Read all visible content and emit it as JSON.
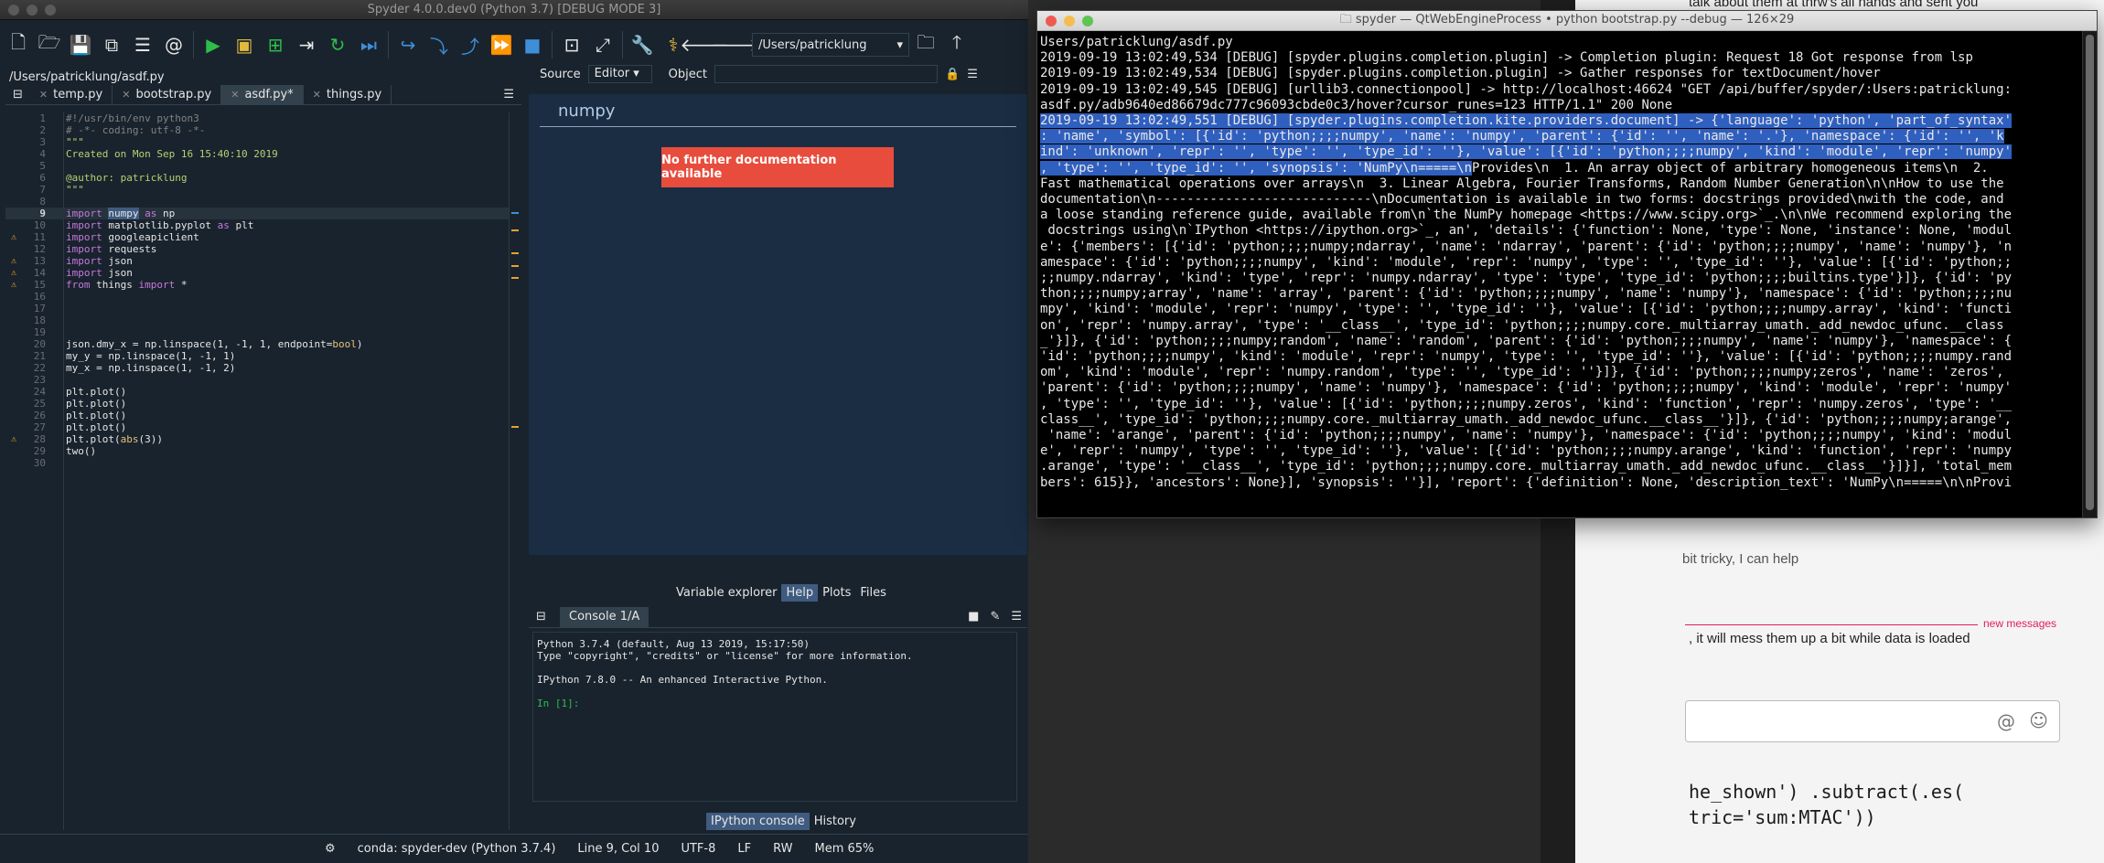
{
  "spyder": {
    "title": "Spyder 4.0.0.dev0 (Python 3.7) [DEBUG MODE 3]",
    "toolbar": {
      "path": "/Users/patricklung",
      "icons": [
        "new-file-icon",
        "open-file-icon",
        "save-icon",
        "save-all-icon",
        "list-icon",
        "at-icon",
        "run-icon",
        "run-cell-icon",
        "run-cell-advance-icon",
        "run-selection-icon",
        "rerun-icon",
        "debug-icon",
        "step-icon",
        "stop-icon",
        "maximize-icon",
        "fullscreen-icon",
        "wrench-icon",
        "python-icon",
        "back-icon",
        "forward-icon",
        "folder-icon",
        "up-icon"
      ]
    },
    "editor": {
      "filepath": "/Users/patricklung/asdf.py",
      "tabs": [
        {
          "label": "temp.py"
        },
        {
          "label": "bootstrap.py"
        },
        {
          "label": "asdf.py*"
        },
        {
          "label": "things.py"
        }
      ],
      "line_numbers": [
        "1",
        "2",
        "3",
        "4",
        "5",
        "6",
        "7",
        "8",
        "9",
        "10",
        "11",
        "12",
        "13",
        "14",
        "15",
        "16",
        "17",
        "18",
        "19",
        "20",
        "21",
        "22",
        "23",
        "24",
        "25",
        "26",
        "27",
        "28",
        "29",
        "30"
      ]
    },
    "help": {
      "source_label": "Source",
      "source_value": "Editor",
      "object_label": "Object",
      "doc_title": "numpy",
      "no_doc": "No further documentation available",
      "tabs": [
        "Variable explorer",
        "Help",
        "Plots",
        "Files"
      ]
    },
    "console": {
      "tab": "Console 1/A",
      "lines": [
        "Python 3.7.4 (default, Aug 13 2019, 15:17:50)",
        "Type \"copyright\", \"credits\" or \"license\" for more information.",
        "",
        "IPython 7.8.0 -- An enhanced Interactive Python.",
        "",
        "In [1]:"
      ],
      "tabs": [
        "IPython console",
        "History"
      ]
    },
    "status": {
      "env": "conda: spyder-dev (Python 3.7.4)",
      "position": "Line 9, Col 10",
      "encoding": "UTF-8",
      "eol": "LF",
      "mode": "RW",
      "mem": "Mem 65%"
    }
  },
  "terminal": {
    "title": "spyder — QtWebEngineProcess • python bootstrap.py --debug — 126×29",
    "lines": [
      "Users/patricklung/asdf.py",
      "2019-09-19 13:02:49,534 [DEBUG] [spyder.plugins.completion.plugin] -> Completion plugin: Request 18 Got response from lsp",
      "2019-09-19 13:02:49,534 [DEBUG] [spyder.plugins.completion.plugin] -> Gather responses for textDocument/hover",
      "2019-09-19 13:02:49,545 [DEBUG] [urllib3.connectionpool] -> http://localhost:46624 \"GET /api/buffer/spyder/:Users:patricklung:",
      "asdf.py/adb9640ed86679dc777c96093cbde0c3/hover?cursor_runes=123 HTTP/1.1\" 200 None"
    ],
    "selected_lines": [
      "2019-09-19 13:02:49,551 [DEBUG] [spyder.plugins.completion.kite.providers.document] -> {'language': 'python', 'part_of_syntax'",
      ": 'name', 'symbol': [{'id': 'python;;;;numpy', 'name': 'numpy', 'parent': {'id': '', 'name': '.'}, 'namespace': {'id': '', 'k",
      "ind': 'unknown', 'repr': '', 'type': '', 'type_id': ''}, 'value': [{'id': 'python;;;;numpy', 'kind': 'module', 'repr': 'numpy'",
      ", 'type': '', 'type_id': '', 'synopsis': 'NumPy\\n=====\\n"
    ],
    "selected_tail": "Provides\\n  1. An array object of arbitrary homogeneous items\\n  2.",
    "rest_lines": [
      "Fast mathematical operations over arrays\\n  3. Linear Algebra, Fourier Transforms, Random Number Generation\\n\\nHow to use the",
      "documentation\\n----------------------------\\nDocumentation is available in two forms: docstrings provided\\nwith the code, and",
      "a loose standing reference guide, available from\\n`the NumPy homepage <https://www.scipy.org>`_.\\n\\nWe recommend exploring the",
      " docstrings using\\n`IPython <https://ipython.org>`_, an', 'details': {'function': None, 'type': None, 'instance': None, 'modul",
      "e': {'members': [{'id': 'python;;;;numpy;ndarray', 'name': 'ndarray', 'parent': {'id': 'python;;;;numpy', 'name': 'numpy'}, 'n",
      "amespace': {'id': 'python;;;;numpy', 'kind': 'module', 'repr': 'numpy', 'type': '', 'type_id': ''}, 'value': [{'id': 'python;;",
      ";;numpy.ndarray', 'kind': 'type', 'repr': 'numpy.ndarray', 'type': 'type', 'type_id': 'python;;;;builtins.type'}]}, {'id': 'py",
      "thon;;;;numpy;array', 'name': 'array', 'parent': {'id': 'python;;;;numpy', 'name': 'numpy'}, 'namespace': {'id': 'python;;;;nu",
      "mpy', 'kind': 'module', 'repr': 'numpy', 'type': '', 'type_id': ''}, 'value': [{'id': 'python;;;;numpy.array', 'kind': 'functi",
      "on', 'repr': 'numpy.array', 'type': '__class__', 'type_id': 'python;;;;numpy.core._multiarray_umath._add_newdoc_ufunc.__class",
      "_'}]}, {'id': 'python;;;;numpy;random', 'name': 'random', 'parent': {'id': 'python;;;;numpy', 'name': 'numpy'}, 'namespace': {",
      "'id': 'python;;;;numpy', 'kind': 'module', 'repr': 'numpy', 'type': '', 'type_id': ''}, 'value': [{'id': 'python;;;;numpy.rand",
      "om', 'kind': 'module', 'repr': 'numpy.random', 'type': '', 'type_id': ''}]}, {'id': 'python;;;;numpy;zeros', 'name': 'zeros',",
      "'parent': {'id': 'python;;;;numpy', 'name': 'numpy'}, 'namespace': {'id': 'python;;;;numpy', 'kind': 'module', 'repr': 'numpy'",
      ", 'type': '', 'type_id': ''}, 'value': [{'id': 'python;;;;numpy.zeros', 'kind': 'function', 'repr': 'numpy.zeros', 'type': '__",
      "class__', 'type_id': 'python;;;;numpy.core._multiarray_umath._add_newdoc_ufunc.__class__'}]}, {'id': 'python;;;;numpy;arange',",
      " 'name': 'arange', 'parent': {'id': 'python;;;;numpy', 'name': 'numpy'}, 'namespace': {'id': 'python;;;;numpy', 'kind': 'modul",
      "e', 'repr': 'numpy', 'type': '', 'type_id': ''}, 'value': [{'id': 'python;;;;numpy.arange', 'kind': 'function', 'repr': 'numpy",
      ".arange', 'type': '__class__', 'type_id': 'python;;;;numpy.core._multiarray_umath._add_newdoc_ufunc.__class__'}]}], 'total_mem",
      "bers': 615}}, 'ancestors': None}], 'synopsis': ''}], 'report': {'definition': None, 'description_text': 'NumPy\\n=====\\n\\nProvi"
    ]
  },
  "chat": {
    "top_text": "talk about them at thrw's all hands and sent you",
    "snippet1": "bit tricky, I can help",
    "new_messages": "new messages",
    "snippet2": ", it will mess them up a bit while data is loaded",
    "code_line1": "he_shown') .subtract(.es(",
    "code_line2": "tric='sum:MTAC'))"
  }
}
